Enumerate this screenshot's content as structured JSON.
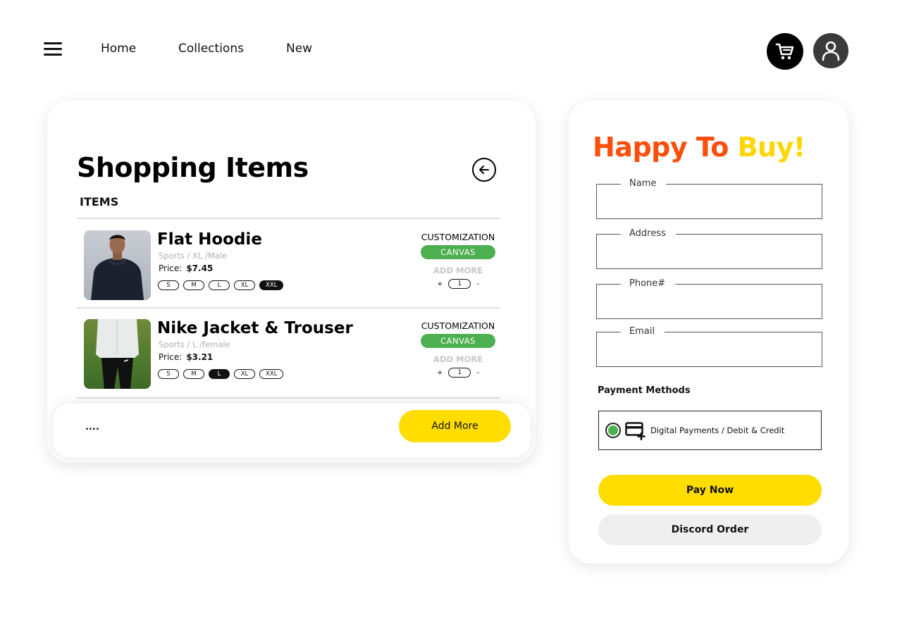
{
  "nav": {
    "links": [
      "Home",
      "Collections",
      "New"
    ]
  },
  "icons": {
    "menu": "hamburger-menu-icon",
    "cart": "shopping-cart-icon",
    "user": "user-profile-icon",
    "back": "arrow-left-circle-icon",
    "card": "credit-card-add-icon"
  },
  "colors": {
    "accent_yellow": "#ffdd00",
    "accent_green": "#4caf50",
    "title_orange": "#ff4d0a",
    "title_yellow": "#ffd600"
  },
  "shopping": {
    "title": "Shopping Items",
    "items_heading": "ITEMS",
    "products": [
      {
        "name": "Flat Hoodie",
        "meta": "Sports / XL /Male",
        "price_label": "Price:",
        "price": "$7.45",
        "sizes": [
          "S",
          "M",
          "L",
          "XL",
          "XXL"
        ],
        "selected_size": "XXL",
        "customization_label": "CUSTOMIZATION",
        "canvas_label": "CANVAS",
        "add_more_label": "ADD MORE",
        "qty_plus": "+",
        "quantity": "1",
        "qty_minus": "-"
      },
      {
        "name": "Nike Jacket & Trouser",
        "meta": "Sports / L /female",
        "price_label": "Price:",
        "price": "$3.21",
        "sizes": [
          "S",
          "M",
          "L",
          "XL",
          "XXL"
        ],
        "selected_size": "L",
        "customization_label": "CUSTOMIZATION",
        "canvas_label": "CANVAS",
        "add_more_label": "ADD MORE",
        "qty_plus": "+",
        "quantity": "1",
        "qty_minus": "-"
      }
    ],
    "footer_dots": "....",
    "add_more_button": "Add More"
  },
  "checkout": {
    "title_part1": "Happy To",
    "title_part2": "Buy!",
    "fields": {
      "name": {
        "label": "Name",
        "value": ""
      },
      "address": {
        "label": "Address",
        "value": ""
      },
      "phone": {
        "label": "Phone#",
        "value": ""
      },
      "email": {
        "label": "Email",
        "value": ""
      }
    },
    "payment_methods_label": "Payment Methods",
    "payment_option": "Digital Payments / Debit & Credit",
    "pay_now": "Pay Now",
    "discord_order": "Discord Order"
  }
}
